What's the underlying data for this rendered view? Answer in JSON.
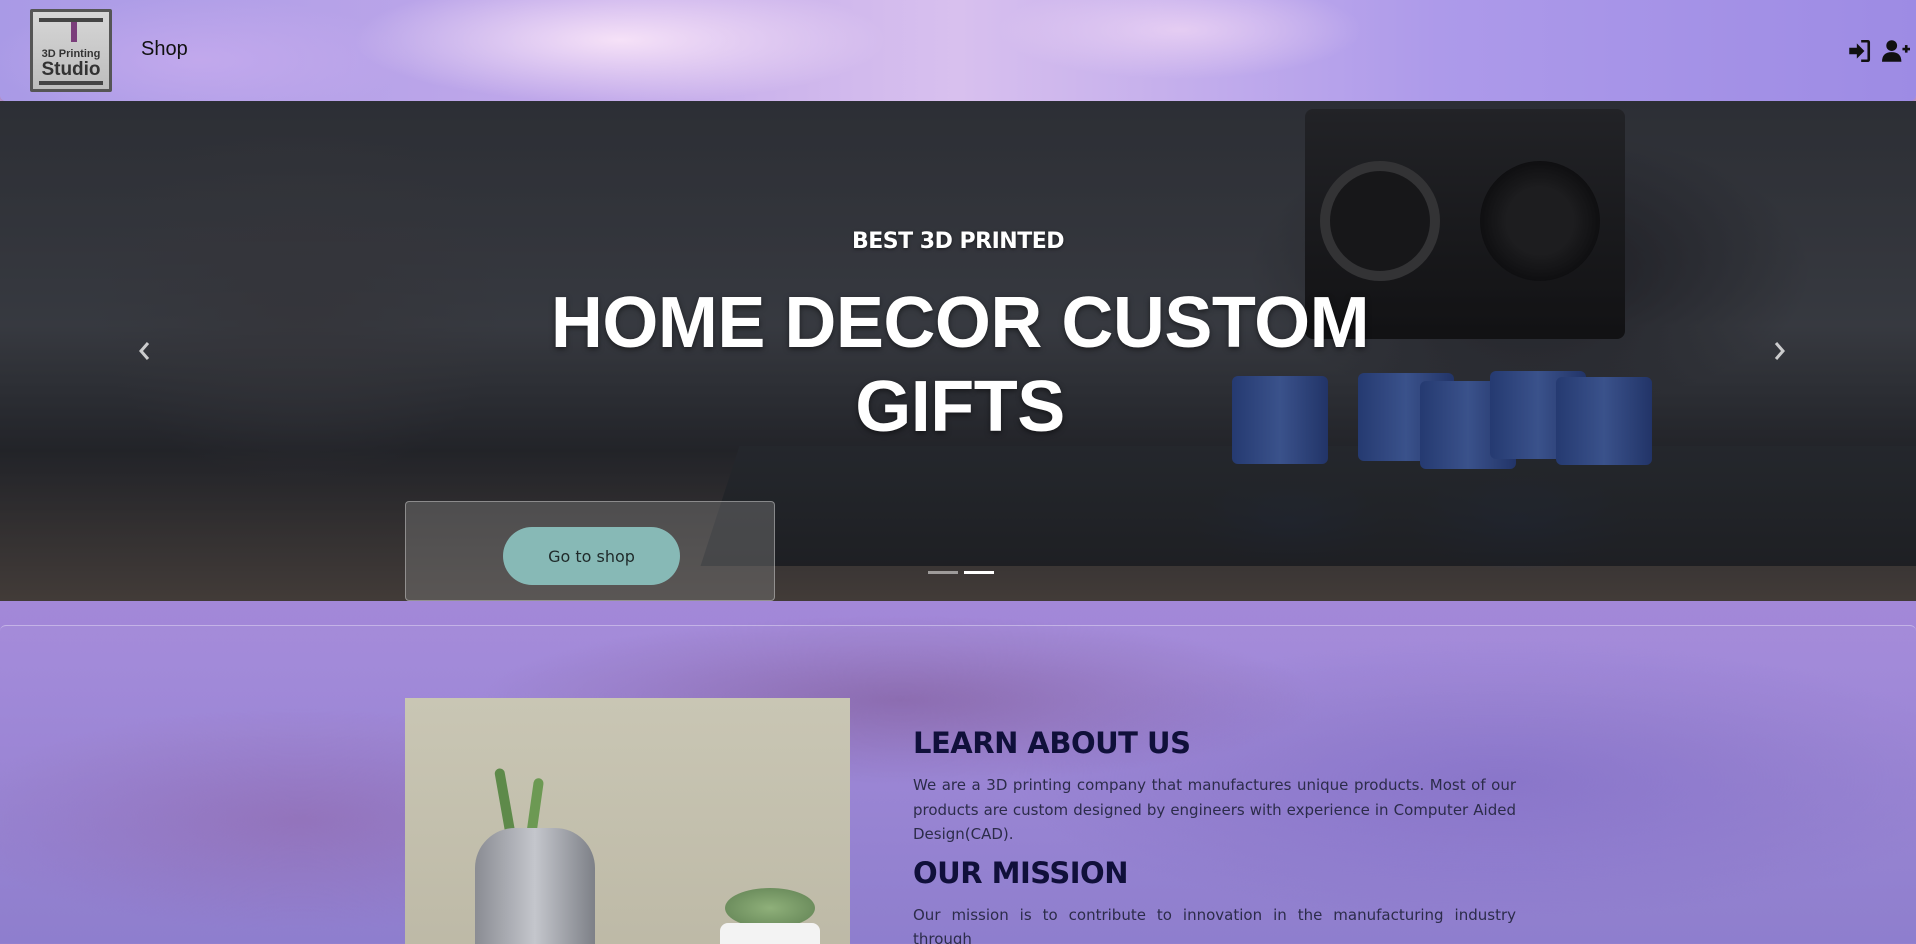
{
  "navbar": {
    "logo": {
      "line1": "3D Printing",
      "line2": "Studio"
    },
    "shop_label": "Shop",
    "icons": [
      "sign-in-icon",
      "user-plus-icon"
    ]
  },
  "hero": {
    "subtitle": "BEST 3D PRINTED",
    "title": "HOME DECOR CUSTOM GIFTS",
    "button_label": "Go to shop",
    "prev_icon": "chevron-left-icon",
    "next_icon": "chevron-right-icon",
    "slides_total": 2,
    "active_slide": 2
  },
  "about": {
    "heading": "LEARN ABOUT US",
    "body": "We are a 3D printing company that manufactures unique products. Most of our products are custom designed by engineers with experience in Computer Aided Design(CAD).",
    "mission_heading": "OUR MISSION",
    "mission_body": "Our mission is to contribute to innovation in the manufacturing industry through"
  },
  "colors": {
    "button": "#87b9b6",
    "heading": "#10103a",
    "navbar": "#b9a3ea"
  }
}
